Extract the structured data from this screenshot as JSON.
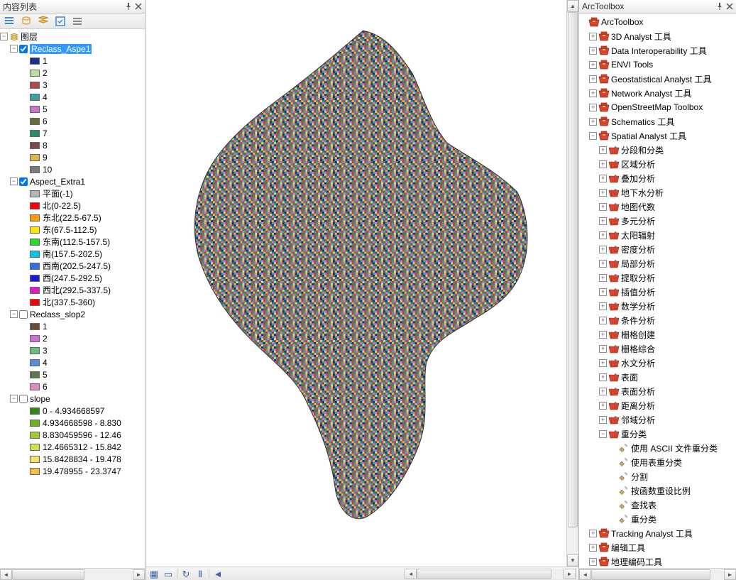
{
  "left_panel": {
    "title": "内容列表",
    "root_label": "图层",
    "layers": {
      "reclass_aspe1": {
        "name": "Reclass_Aspe1",
        "checked": true,
        "selected": true,
        "classes": [
          {
            "label": "1",
            "color": "#1c2e8a"
          },
          {
            "label": "2",
            "color": "#b8e09a"
          },
          {
            "label": "3",
            "color": "#b04a4a"
          },
          {
            "label": "4",
            "color": "#3aa0a0"
          },
          {
            "label": "5",
            "color": "#d070d0"
          },
          {
            "label": "6",
            "color": "#6b6b33"
          },
          {
            "label": "7",
            "color": "#2e8a6e"
          },
          {
            "label": "8",
            "color": "#7a4a4a"
          },
          {
            "label": "9",
            "color": "#e0b84a"
          },
          {
            "label": "10",
            "color": "#7a7a7a"
          }
        ]
      },
      "aspect_extra1": {
        "name": "Aspect_Extra1",
        "checked": true,
        "classes": [
          {
            "label": "平面(-1)",
            "color": "#b5b5b5"
          },
          {
            "label": "北(0-22.5)",
            "color": "#ff0000"
          },
          {
            "label": "东北(22.5-67.5)",
            "color": "#ff9900"
          },
          {
            "label": "东(67.5-112.5)",
            "color": "#ffe600"
          },
          {
            "label": "东南(112.5-157.5)",
            "color": "#22dd22"
          },
          {
            "label": "南(157.5-202.5)",
            "color": "#00c8e6"
          },
          {
            "label": "西南(202.5-247.5)",
            "color": "#2e6fe6"
          },
          {
            "label": "西(247.5-292.5)",
            "color": "#1919d4"
          },
          {
            "label": "西北(292.5-337.5)",
            "color": "#e619c8"
          },
          {
            "label": "北(337.5-360)",
            "color": "#ff0000"
          }
        ]
      },
      "reclass_slop2": {
        "name": "Reclass_slop2",
        "checked": false,
        "classes": [
          {
            "label": "1",
            "color": "#6b4a33"
          },
          {
            "label": "2",
            "color": "#d070d0"
          },
          {
            "label": "3",
            "color": "#66c07a"
          },
          {
            "label": "4",
            "color": "#5a8ae0"
          },
          {
            "label": "5",
            "color": "#5a7a4a"
          },
          {
            "label": "6",
            "color": "#e08ac0"
          }
        ]
      },
      "slope": {
        "name": "slope",
        "checked": false,
        "classes": [
          {
            "label": "0 - 4.934668597",
            "color": "#2e8a0a"
          },
          {
            "label": "4.934668598 - 8.830",
            "color": "#6bb31c"
          },
          {
            "label": "8.830459596 - 12.46",
            "color": "#a0cc2e"
          },
          {
            "label": "12.4665312 - 15.842",
            "color": "#d4e04a"
          },
          {
            "label": "15.8428834 - 19.478",
            "color": "#f2e666"
          },
          {
            "label": "19.478955 - 23.3747",
            "color": "#f2c04a"
          }
        ]
      }
    }
  },
  "right_panel": {
    "title": "ArcToolbox",
    "root": "ArcToolbox",
    "toolboxes": [
      {
        "name": "3D Analyst 工具",
        "expanded": false
      },
      {
        "name": "Data Interoperability 工具",
        "expanded": false
      },
      {
        "name": "ENVI Tools",
        "expanded": false
      },
      {
        "name": "Geostatistical Analyst 工具",
        "expanded": false
      },
      {
        "name": "Network Analyst 工具",
        "expanded": false
      },
      {
        "name": "OpenStreetMap Toolbox",
        "expanded": false
      },
      {
        "name": "Schematics 工具",
        "expanded": false
      }
    ],
    "spatial_analyst": {
      "name": "Spatial Analyst 工具",
      "toolsets": [
        "分段和分类",
        "区域分析",
        "叠加分析",
        "地下水分析",
        "地图代数",
        "多元分析",
        "太阳辐射",
        "密度分析",
        "局部分析",
        "提取分析",
        "插值分析",
        "数学分析",
        "条件分析",
        "栅格创建",
        "栅格综合",
        "水文分析",
        "表面",
        "表面分析",
        "距离分析",
        "邻域分析"
      ],
      "reclass_toolset": {
        "name": "重分类",
        "tools": [
          "使用 ASCII 文件重分类",
          "使用表重分类",
          "分割",
          "按函数重设比例",
          "查找表",
          "重分类"
        ]
      }
    },
    "more_toolboxes": [
      "Tracking Analyst 工具",
      "编辑工具",
      "地理编码工具"
    ]
  },
  "view_toolbar": {
    "data_view": "数据视图",
    "layout_view": "布局视图",
    "refresh": "刷新",
    "pause": "暂停绘制"
  }
}
